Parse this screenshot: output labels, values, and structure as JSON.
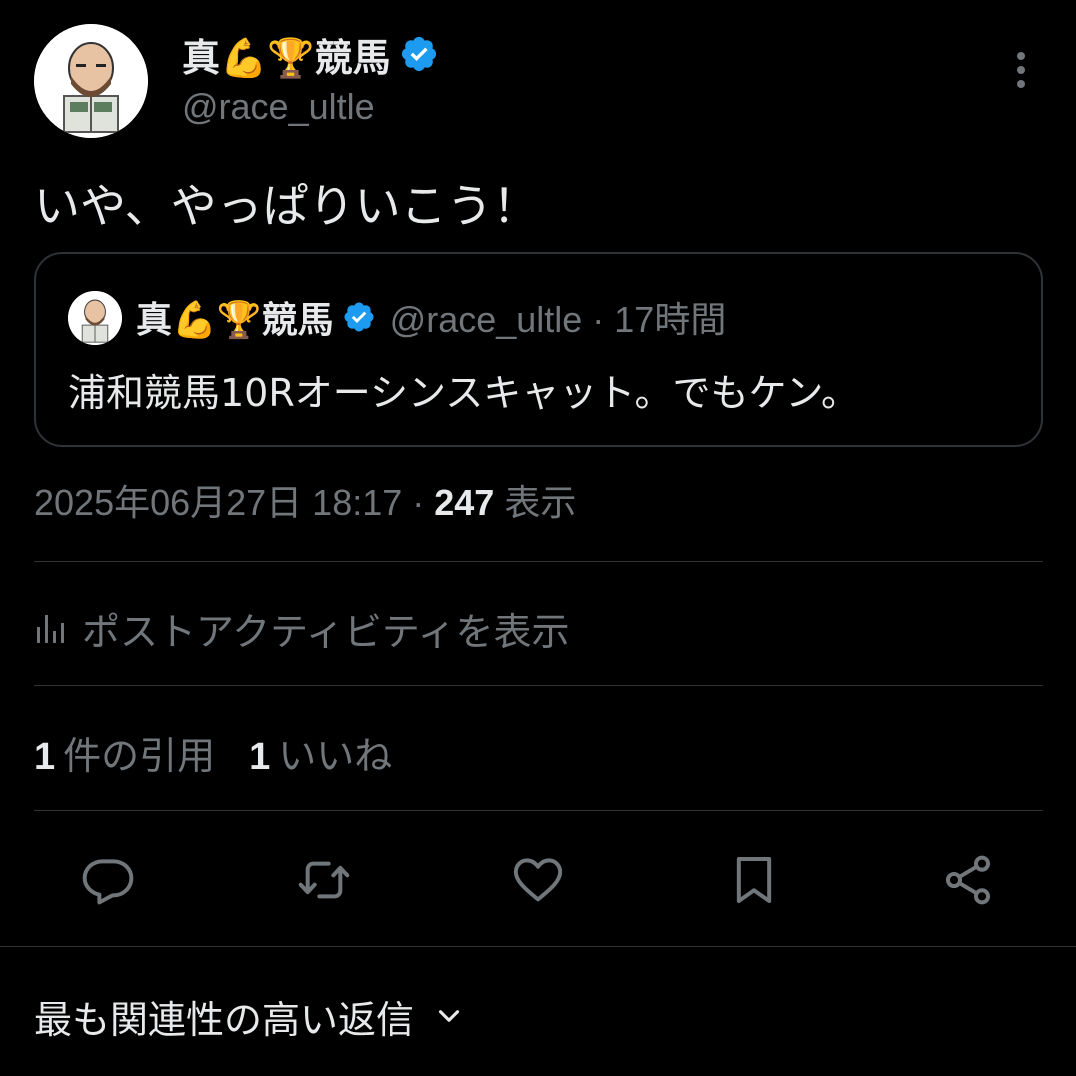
{
  "author": {
    "display_name": "真💪🏆競馬",
    "handle": "@race_ultle",
    "verified": true,
    "avatar_icon": "bald-bearded-man-reading-newspaper-avatar"
  },
  "tweet": {
    "text": "いや、やっぱりいこう！"
  },
  "quoted": {
    "display_name": "真💪🏆競馬",
    "handle_time": "@race_ultle · 17時間",
    "text": "浦和競馬10Rオーシンスキャット。でもケン。"
  },
  "meta": {
    "datetime": "2025年06月27日 18:17 · ",
    "views": "247",
    "views_label": " 表示"
  },
  "activity": {
    "label": "ポストアクティビティを表示",
    "icon": "bar-chart-icon"
  },
  "stats": {
    "quotes_count": "1",
    "quotes_label": "件の引用",
    "likes_count": "1",
    "likes_label": "いいね"
  },
  "actions": [
    "reply-icon",
    "repost-icon",
    "like-icon",
    "bookmark-icon",
    "share-icon"
  ],
  "replies": {
    "sort_label": "最も関連性の高い返信"
  },
  "colors": {
    "background": "#000000",
    "primary_text": "#e7e9ea",
    "secondary_text": "#71767b",
    "border": "#2f3336",
    "verified": "#1d9bf0"
  }
}
